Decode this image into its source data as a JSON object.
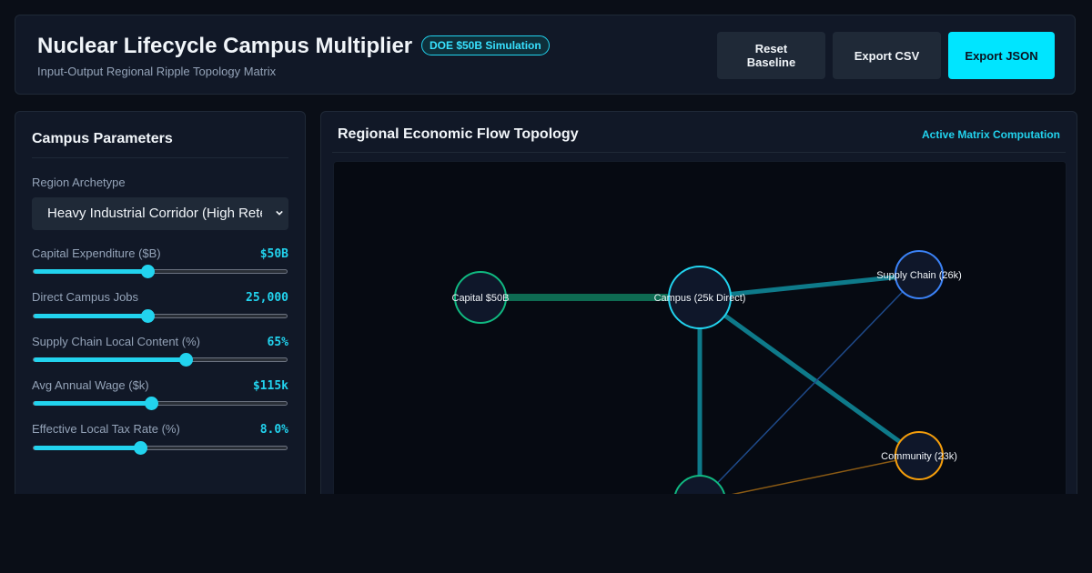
{
  "header": {
    "title": "Nuclear Lifecycle Campus Multiplier",
    "badge": "DOE $50B Simulation",
    "subtitle": "Input-Output Regional Ripple Topology Matrix",
    "buttons": {
      "reset": "Reset Baseline",
      "export_csv": "Export CSV",
      "export_json": "Export JSON"
    }
  },
  "params": {
    "title": "Campus Parameters",
    "region_label": "Region Archetype",
    "region_value": "Heavy Industrial Corridor (High Retention)",
    "sliders": [
      {
        "label": "Capital Expenditure ($B)",
        "value": "$50B",
        "fraction": 0.45
      },
      {
        "label": "Direct Campus Jobs",
        "value": "25,000",
        "fraction": 0.45
      },
      {
        "label": "Supply Chain Local Content (%)",
        "value": "65%",
        "fraction": 0.6
      },
      {
        "label": "Avg Annual Wage ($k)",
        "value": "$115k",
        "fraction": 0.465
      },
      {
        "label": "Effective Local Tax Rate (%)",
        "value": "8.0%",
        "fraction": 0.42
      }
    ]
  },
  "topology": {
    "title": "Regional Economic Flow Topology",
    "status": "Active Matrix Computation",
    "nodes": [
      {
        "id": "capital",
        "label": "Capital $50B",
        "color": "#10b981"
      },
      {
        "id": "campus",
        "label": "Campus (25k Direct)",
        "color": "#22d3ee"
      },
      {
        "id": "supply",
        "label": "Supply Chain (26k)",
        "color": "#3b82f6"
      },
      {
        "id": "community",
        "label": "Community (23k)",
        "color": "#f59e0b"
      },
      {
        "id": "induced",
        "label": "",
        "color": "#10b981"
      }
    ]
  },
  "colors": {
    "accent": "#22d3ee",
    "background": "#0a0e17",
    "panel": "#111827"
  }
}
